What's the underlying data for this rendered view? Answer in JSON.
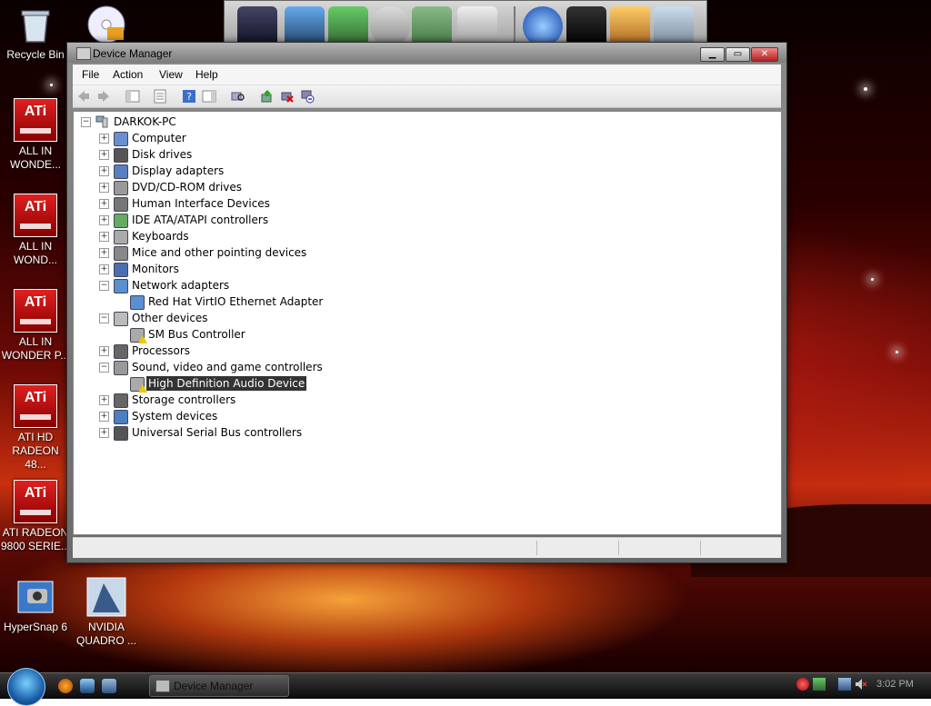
{
  "desktop": {
    "icons": [
      {
        "label": "Recycle Bin"
      },
      {
        "label": "ALL IN WONDE..."
      },
      {
        "label": "ALL IN WOND..."
      },
      {
        "label": "ALL IN WONDER P..."
      },
      {
        "label": "ATI HD RADEON 48..."
      },
      {
        "label": "ATI RADEON 9800 SERIE..."
      },
      {
        "label": "HyperSnap 6"
      },
      {
        "label": "NVIDIA QUADRO ..."
      }
    ],
    "ati_text": "ATi"
  },
  "window": {
    "title": "Device Manager",
    "controls": {
      "minimize": "▁",
      "maximize": "▭",
      "close": "✕"
    },
    "menu": [
      "File",
      "Action",
      "View",
      "Help"
    ]
  },
  "tree": {
    "root": "DARKOK-PC",
    "nodes": [
      {
        "label": "Computer",
        "icon": "computer-icon",
        "expander": "+"
      },
      {
        "label": "Disk drives",
        "icon": "disk-icon",
        "expander": "+"
      },
      {
        "label": "Display adapters",
        "icon": "display-icon",
        "expander": "+"
      },
      {
        "label": "DVD/CD-ROM drives",
        "icon": "dvd-icon",
        "expander": "+"
      },
      {
        "label": "Human Interface Devices",
        "icon": "hid-icon",
        "expander": "+"
      },
      {
        "label": "IDE ATA/ATAPI controllers",
        "icon": "ide-icon",
        "expander": "+"
      },
      {
        "label": "Keyboards",
        "icon": "keyboard-icon",
        "expander": "+"
      },
      {
        "label": "Mice and other pointing devices",
        "icon": "mouse-icon",
        "expander": "+"
      },
      {
        "label": "Monitors",
        "icon": "monitor-icon",
        "expander": "+"
      },
      {
        "label": "Network adapters",
        "icon": "network-icon",
        "expander": "−"
      },
      {
        "label": "Red Hat VirtIO Ethernet Adapter",
        "icon": "network-icon",
        "child": true
      },
      {
        "label": "Other devices",
        "icon": "unknown-device-icon",
        "expander": "−"
      },
      {
        "label": "SM Bus Controller",
        "icon": "warning-device-icon",
        "child": true
      },
      {
        "label": "Processors",
        "icon": "processor-icon",
        "expander": "+"
      },
      {
        "label": "Sound, video and game controllers",
        "icon": "speaker-icon",
        "expander": "−"
      },
      {
        "label": "High Definition Audio Device",
        "icon": "warning-device-icon",
        "child": true,
        "selected": true
      },
      {
        "label": "Storage controllers",
        "icon": "storage-icon",
        "expander": "+"
      },
      {
        "label": "System devices",
        "icon": "system-icon",
        "expander": "+"
      },
      {
        "label": "Universal Serial Bus controllers",
        "icon": "usb-icon",
        "expander": "+"
      }
    ]
  },
  "taskbar": {
    "active_task": "Device Manager",
    "clock": "3:02 PM"
  }
}
